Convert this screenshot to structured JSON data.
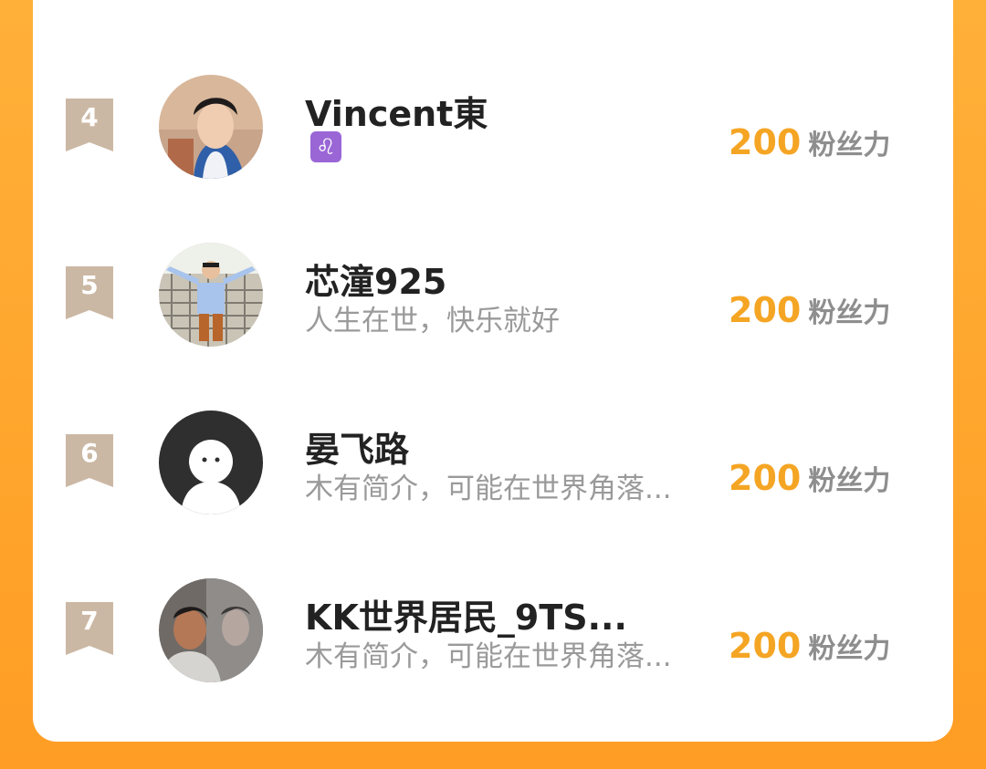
{
  "ranking": {
    "items": [
      {
        "rank": "4",
        "name": "Vincent東",
        "bio": "",
        "zodiac_symbol": "♌",
        "score": "200",
        "unit": "粉丝力"
      },
      {
        "rank": "5",
        "name": "芯潼925",
        "bio": "人生在世，快乐就好",
        "score": "200",
        "unit": "粉丝力"
      },
      {
        "rank": "6",
        "name": "晏飞路",
        "bio": "木有简介，可能在世界角落...",
        "score": "200",
        "unit": "粉丝力"
      },
      {
        "rank": "7",
        "name": "KK世界居民_9TS...",
        "bio": "木有简介，可能在世界角落...",
        "score": "200",
        "unit": "粉丝力"
      }
    ]
  },
  "colors": {
    "background": "#ff9d24",
    "score": "#f5a524",
    "unit": "#8e8e8e",
    "rank_badge": "#c9b6a2",
    "bio": "#9a9a9a",
    "zodiac": "#9a66d6"
  },
  "icons": {
    "rank_badge": "ribbon-badge-icon",
    "zodiac": "leo-zodiac-icon",
    "default_avatar": "default-avatar-icon"
  }
}
